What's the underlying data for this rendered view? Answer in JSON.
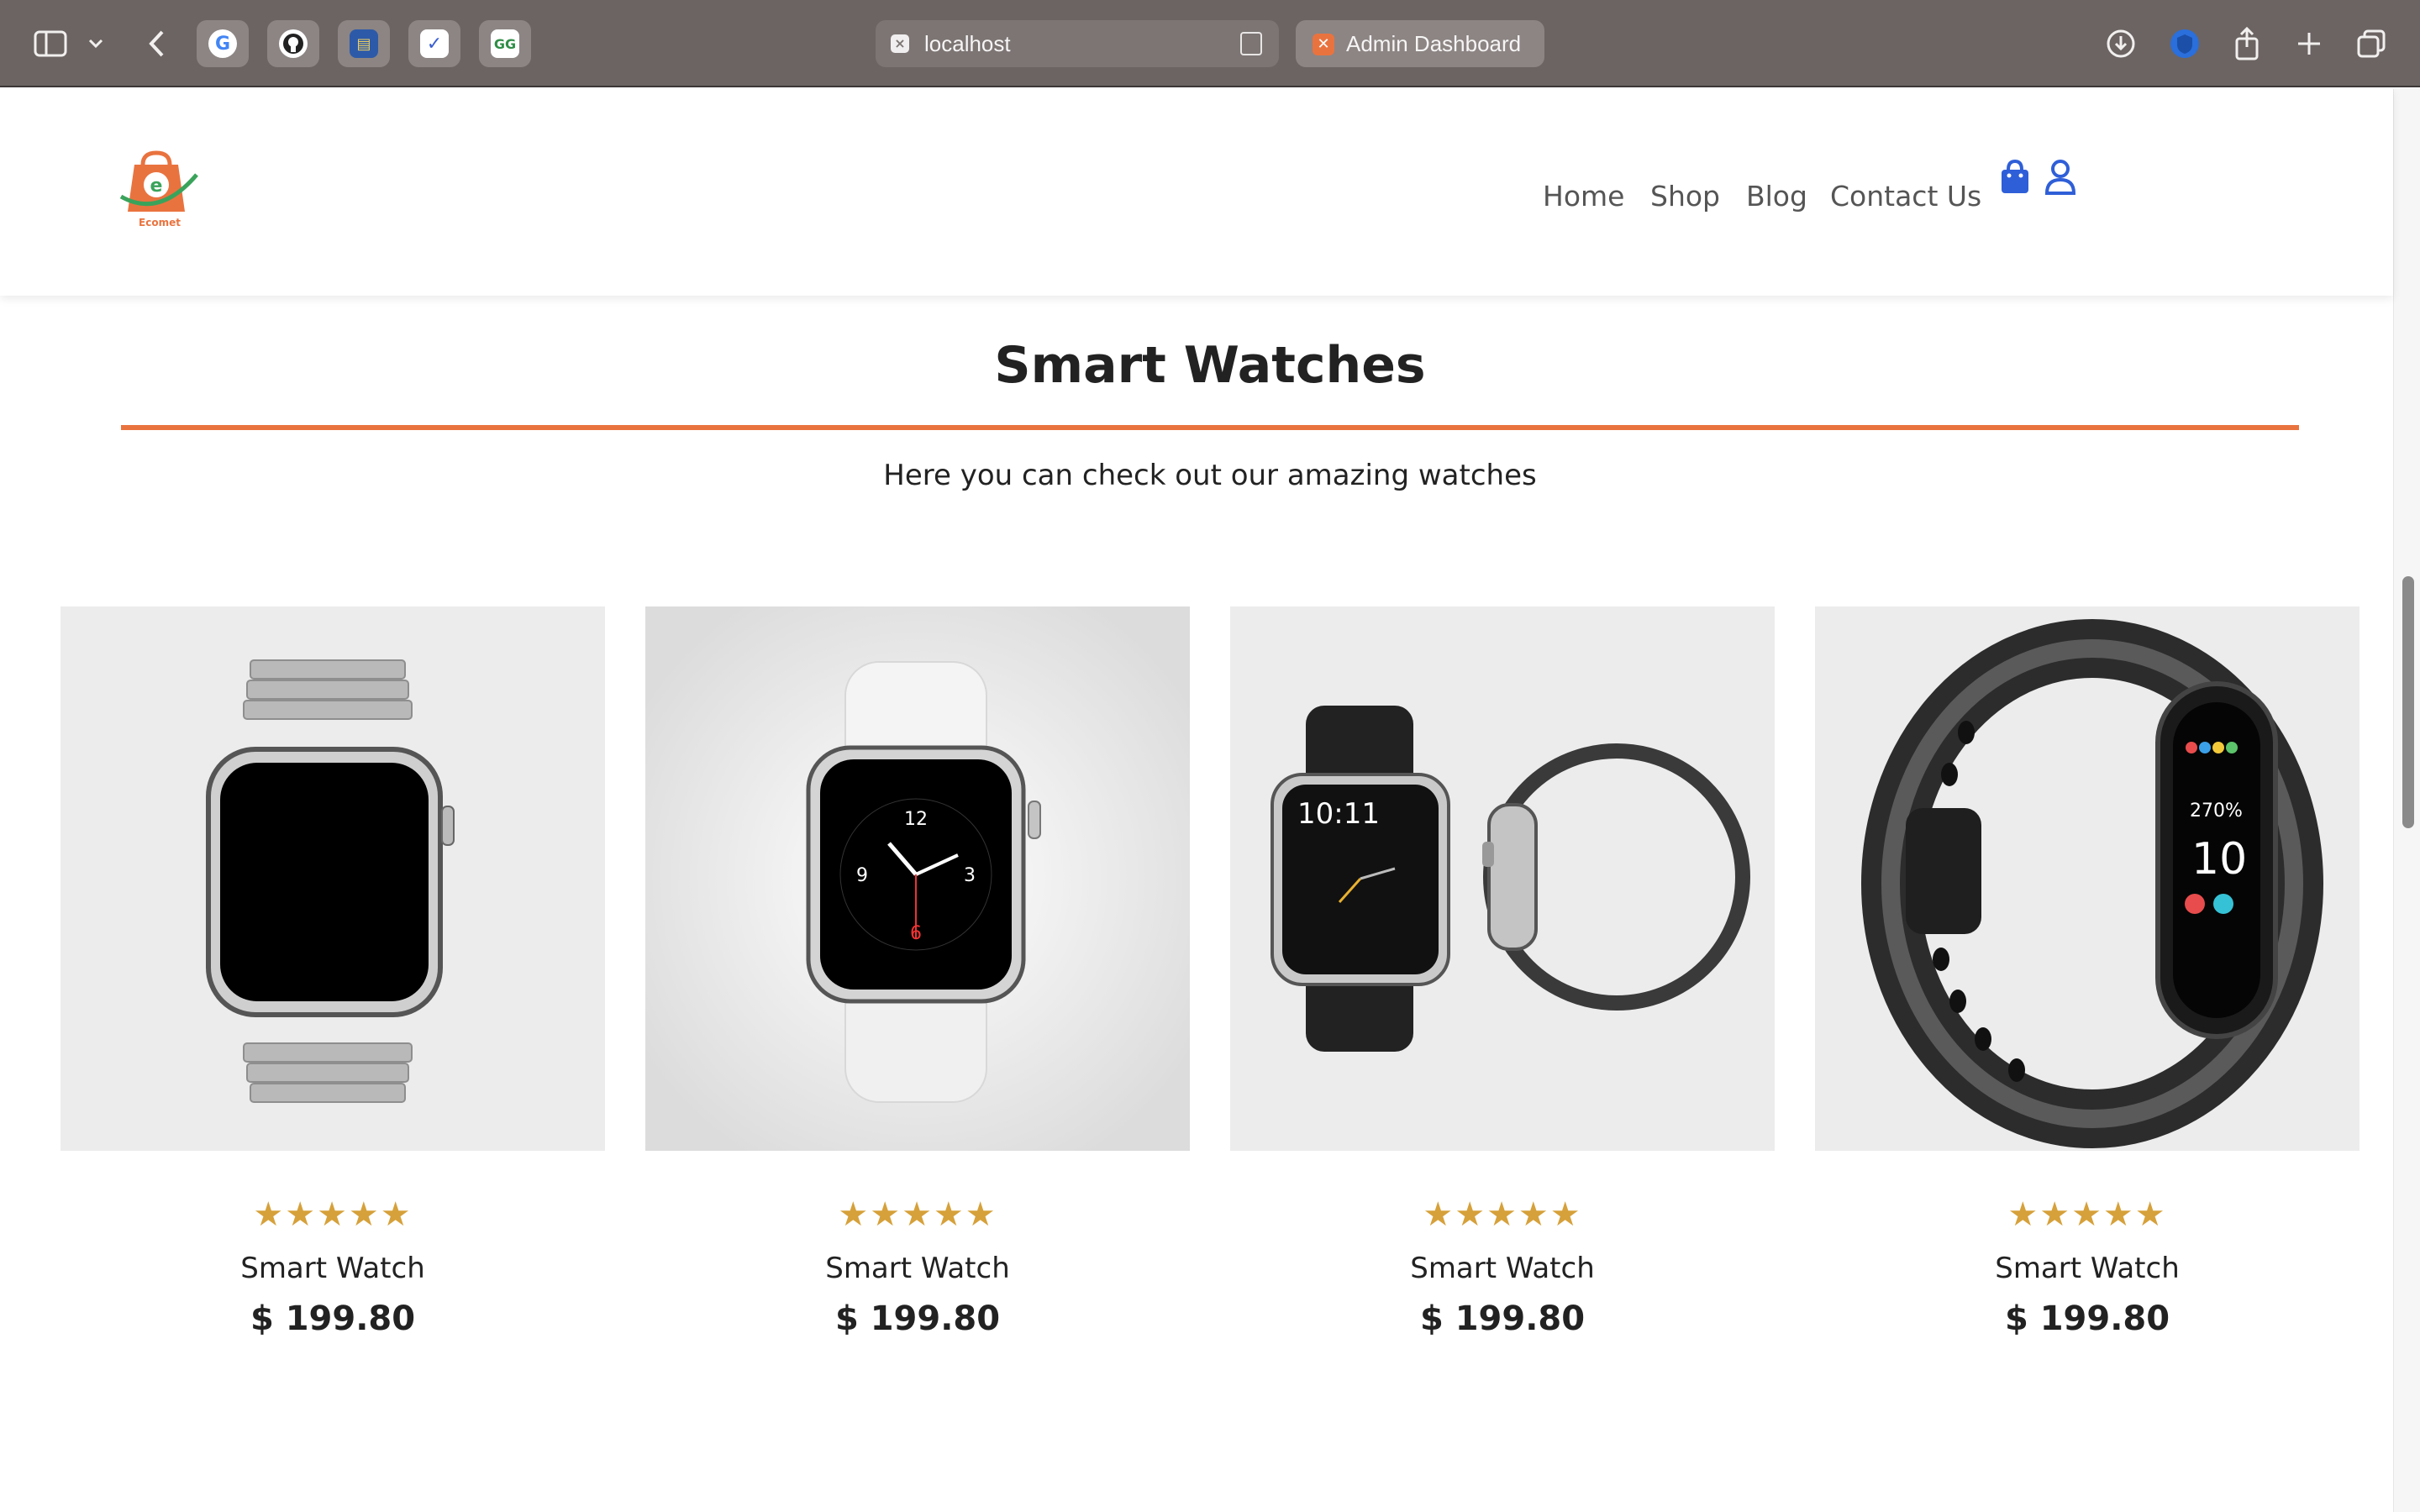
{
  "browser": {
    "url": "localhost",
    "tab_title": "Admin Dashboard",
    "tab_favicons": [
      "google-icon",
      "github-icon",
      "notes-icon",
      "bird-app-icon",
      "geeksforgeeks-icon"
    ]
  },
  "site": {
    "logo_text": "Ecomet",
    "nav": [
      "Home",
      "Shop",
      "Blog",
      "Contact Us"
    ],
    "accent": "#e9733f",
    "icon_color": "#2f5fd8"
  },
  "section": {
    "title": "Smart Watches",
    "subtitle": "Here you can check out our amazing watches"
  },
  "products": [
    {
      "name": "Smart Watch",
      "price": "$ 199.80",
      "rating": 5,
      "stars": "★★★★★"
    },
    {
      "name": "Smart Watch",
      "price": "$ 199.80",
      "rating": 5,
      "stars": "★★★★★"
    },
    {
      "name": "Smart Watch",
      "price": "$ 199.80",
      "rating": 5,
      "stars": "★★★★★"
    },
    {
      "name": "Smart Watch",
      "price": "$ 199.80",
      "rating": 5,
      "stars": "★★★★★"
    }
  ]
}
